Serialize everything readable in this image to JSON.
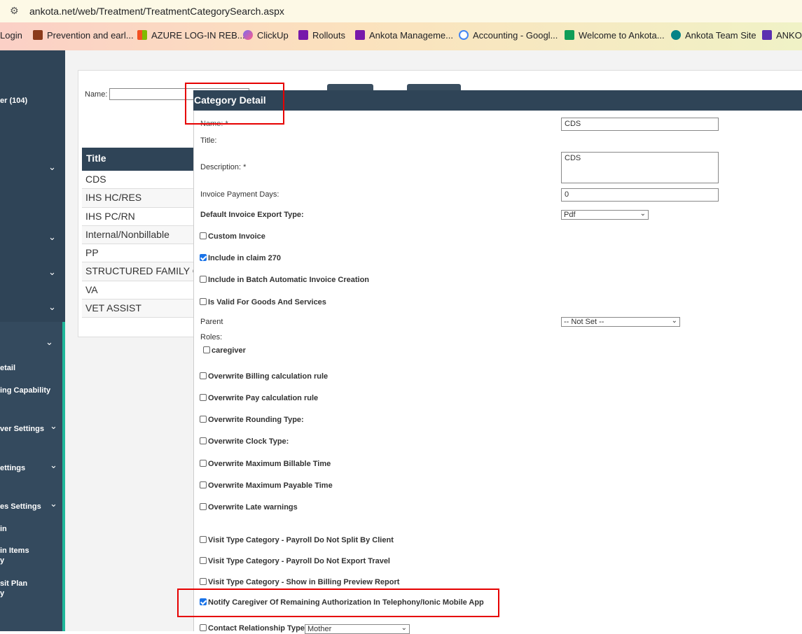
{
  "browser": {
    "url": "ankota.net/web/Treatment/TreatmentCategorySearch.aspx",
    "bookmarks": [
      "Login",
      "Prevention and earl...",
      "AZURE LOG-IN REB...",
      "ClickUp",
      "Rollouts",
      "Ankota Manageme...",
      "Accounting - Googl...",
      "Welcome to Ankota...",
      "Ankota Team Site",
      "ANKOT"
    ]
  },
  "sidebar": {
    "items": [
      "er (104)",
      "etail",
      "ing Capability",
      "ver Settings",
      "ettings",
      "es Settings",
      "in",
      "in Items",
      "y",
      "sit Plan",
      "y"
    ]
  },
  "search": {
    "name_label": "Name:"
  },
  "table": {
    "header": "Title",
    "rows": [
      "CDS",
      "IHS HC/RES",
      "IHS PC/RN",
      "Internal/Nonbillable",
      "PP",
      "STRUCTURED FAMILY CA",
      "VA",
      "VET ASSIST"
    ]
  },
  "modal": {
    "title": "Category Detail",
    "name_label": "Name: *",
    "name_value": "CDS",
    "title_label": "Title:",
    "description_label": "Description: *",
    "description_value": "CDS",
    "invoice_days_label": "Invoice Payment Days:",
    "invoice_days_value": "0",
    "export_type_label": "Default Invoice Export Type:",
    "export_type_value": "Pdf",
    "custom_invoice": "Custom Invoice",
    "include_claim": "Include in claim 270",
    "include_batch": "Include in Batch Automatic Invoice Creation",
    "valid_goods": "Is Valid For Goods And Services",
    "parent_label": "Parent",
    "parent_value": "-- Not Set --",
    "roles_label": "Roles:",
    "role_caregiver": "caregiver",
    "ow_billing": "Overwrite Billing calculation rule",
    "ow_pay": "Overwrite Pay calculation rule",
    "ow_rounding": "Overwrite Rounding Type:",
    "ow_clock": "Overwrite Clock Type:",
    "ow_max_billable": "Overwrite Maximum Billable Time",
    "ow_max_payable": "Overwrite Maximum Payable Time",
    "ow_late": "Overwrite Late warnings",
    "vt_payroll_split": "Visit Type Category - Payroll Do Not Split By Client",
    "vt_payroll_travel": "Visit Type Category - Payroll Do Not Export Travel",
    "vt_billing_preview": "Visit Type Category - Show in Billing Preview Report",
    "notify_caregiver": "Notify Caregiver Of Remaining Authorization In Telephony/Ionic Mobile App",
    "contact_rel_label": "Contact Relationship Type",
    "contact_rel_value": "Mother"
  },
  "colors": {
    "header_bg": "#2f4457",
    "highlight_red": "#e60000",
    "accent_green": "#1fb79a"
  }
}
